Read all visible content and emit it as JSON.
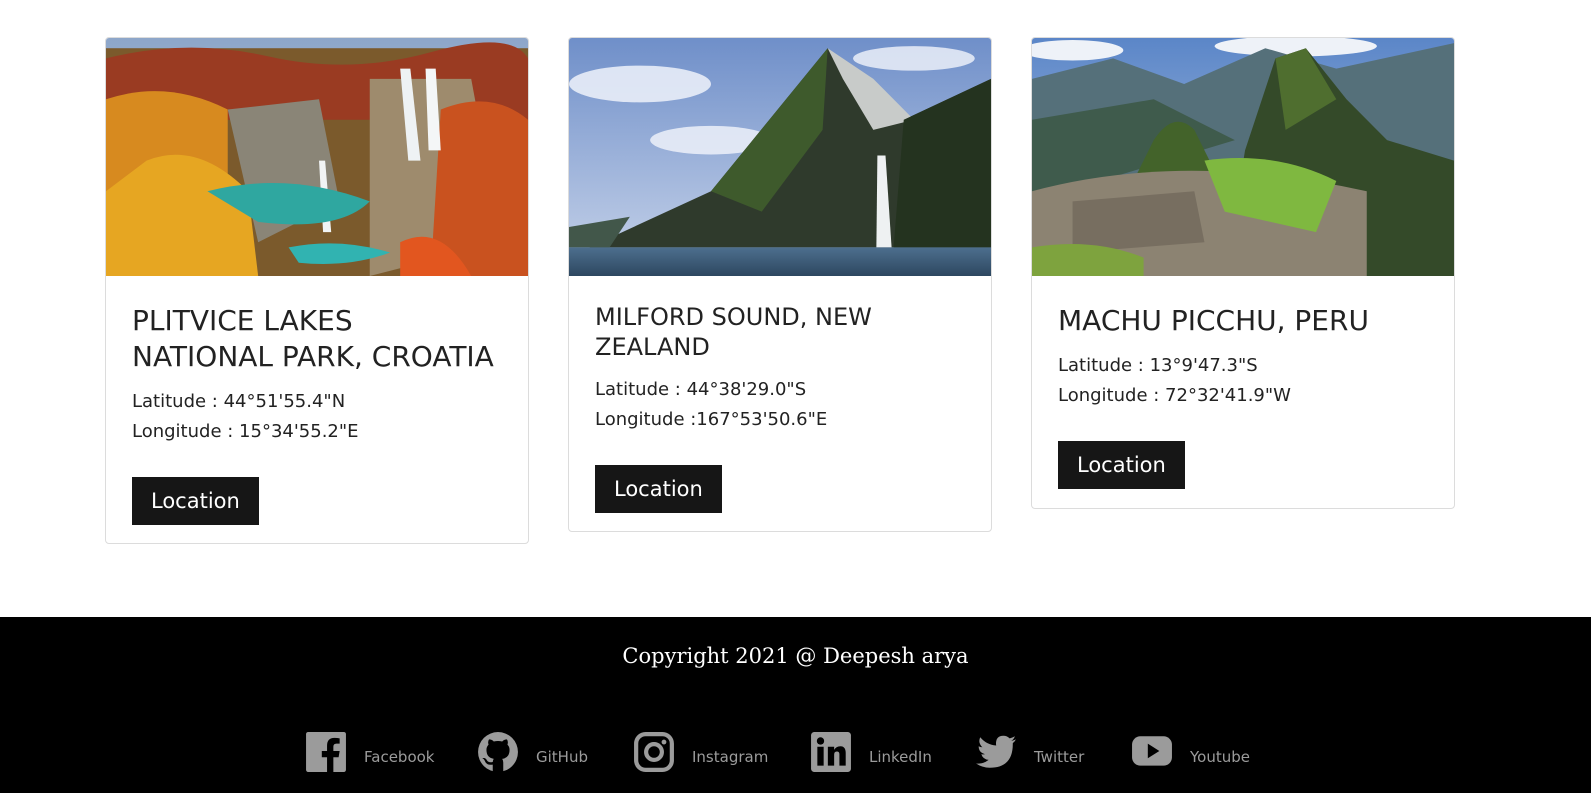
{
  "cards": [
    {
      "title": "Plitvice Lakes National Park, Croatia",
      "latitude": "Latitude : 44°51'55.4\"N",
      "longitude": "Longitude : 15°34'55.2\"E",
      "button": "Location",
      "image": "autumn-waterfalls-lakes-photo"
    },
    {
      "title": "Milford Sound, New Zealand",
      "latitude": "Latitude : 44°38'29.0\"S",
      "longitude": "Longitude :167°53'50.6\"E",
      "button": "Location",
      "image": "fjord-mountain-waterfall-photo"
    },
    {
      "title": "Machu Picchu, Peru",
      "latitude": "Latitude : 13°9'47.3\"S",
      "longitude": "Longitude : 72°32'41.9\"W",
      "button": "Location",
      "image": "inca-ruins-mountain-photo"
    }
  ],
  "footer": {
    "copyright": "Copyright 2021 @ Deepesh arya",
    "links": [
      {
        "label": "Facebook",
        "icon": "facebook-icon"
      },
      {
        "label": "GitHub",
        "icon": "github-icon"
      },
      {
        "label": "Instagram",
        "icon": "instagram-icon"
      },
      {
        "label": "LinkedIn",
        "icon": "linkedin-icon"
      },
      {
        "label": "Twitter",
        "icon": "twitter-icon"
      },
      {
        "label": "Youtube",
        "icon": "youtube-icon"
      }
    ]
  },
  "colors": {
    "footer_bg": "#000000",
    "button_bg": "#161616",
    "icon_grey": "#9b9b9b"
  }
}
